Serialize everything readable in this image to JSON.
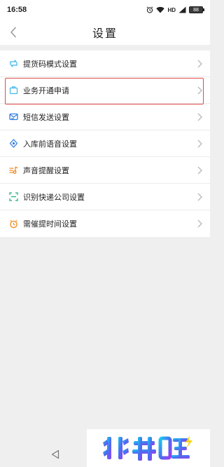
{
  "status_bar": {
    "time": "16:58",
    "network": "HD",
    "battery": "88"
  },
  "header": {
    "title": "设置"
  },
  "settings": {
    "items": [
      {
        "label": "提货码模式设置",
        "icon": "pickup-code-icon",
        "color": "#3fb6e8"
      },
      {
        "label": "业务开通申请",
        "icon": "business-icon",
        "color": "#3fb6e8"
      },
      {
        "label": "短信发送设置",
        "icon": "sms-icon",
        "color": "#2f7de1"
      },
      {
        "label": "入库前语音设置",
        "icon": "voice-icon",
        "color": "#2f7de1"
      },
      {
        "label": "声音提醒设置",
        "icon": "sound-icon",
        "color": "#f08a24"
      },
      {
        "label": "识别快递公司设置",
        "icon": "scan-icon",
        "color": "#22b07d"
      },
      {
        "label": "需催提时间设置",
        "icon": "alarm-icon",
        "color": "#f08a24"
      }
    ]
  },
  "watermark": {
    "text": "兆升旺"
  },
  "colors": {
    "highlight_border": "#e24a4a",
    "background": "#efefef"
  }
}
